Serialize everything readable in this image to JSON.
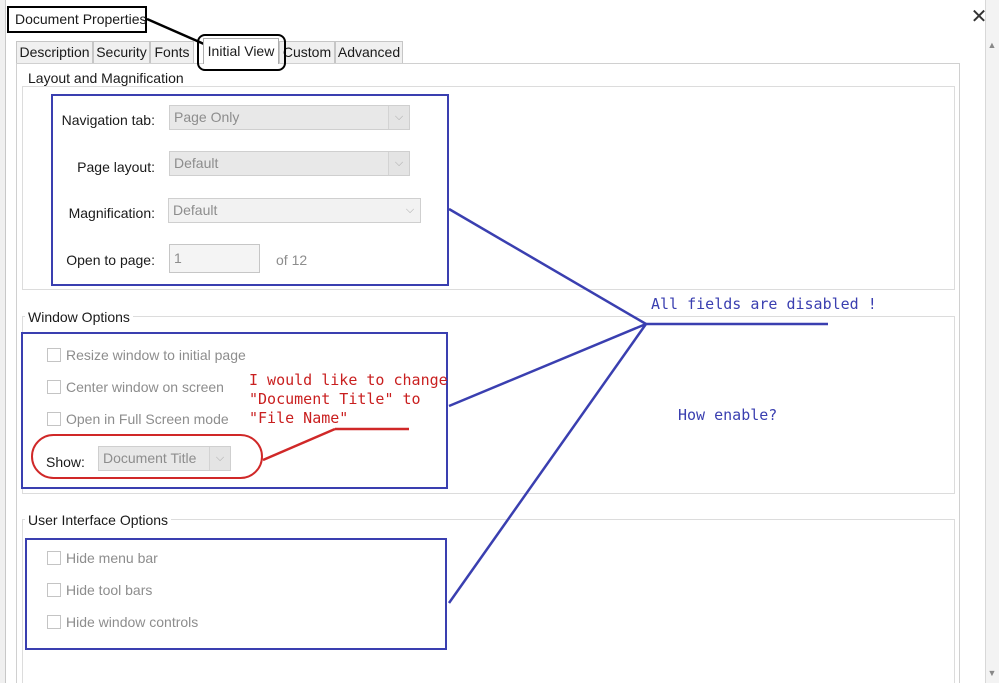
{
  "window": {
    "title": "Document Properties",
    "close_glyph": "✕"
  },
  "tabs": [
    {
      "label": "Description"
    },
    {
      "label": "Security"
    },
    {
      "label": "Fonts"
    },
    {
      "label": "Initial View",
      "active": true
    },
    {
      "label": "Custom"
    },
    {
      "label": "Advanced"
    }
  ],
  "layout_magnification": {
    "title": "Layout and Magnification",
    "navigation_tab": {
      "label": "Navigation tab:",
      "value": "Page Only"
    },
    "page_layout": {
      "label": "Page layout:",
      "value": "Default"
    },
    "magnification": {
      "label": "Magnification:",
      "value": "Default"
    },
    "open_to_page": {
      "label": "Open to page:",
      "value": "1",
      "suffix": "of 12"
    }
  },
  "window_options": {
    "title": "Window Options",
    "resize": "Resize window to initial page",
    "center": "Center window on screen",
    "fullscreen": "Open in Full Screen mode",
    "show": {
      "label": "Show:",
      "value": "Document Title"
    }
  },
  "ui_options": {
    "title": "User Interface Options",
    "hide_menu": "Hide menu bar",
    "hide_toolbars": "Hide tool bars",
    "hide_window_controls": "Hide window controls"
  },
  "annotations": {
    "all_disabled": "All fields are disabled !",
    "how_enable": "How enable?",
    "change_request": [
      "I would like to change",
      "\"Document Title\" to",
      "\"File Name\""
    ]
  },
  "colors": {
    "annotation_blue": "#3a3fb0",
    "annotation_red": "#d02828",
    "disabled_text": "#8d8d8d"
  }
}
